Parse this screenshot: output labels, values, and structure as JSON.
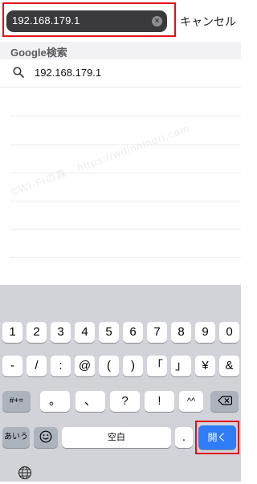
{
  "search": {
    "value": "192.168.179.1",
    "clear_icon": "clear-icon",
    "cancel_label": "キャンセル"
  },
  "suggestions": {
    "section_title": "Google検索",
    "items": [
      {
        "text": "192.168.179.1",
        "icon": "search-icon"
      }
    ]
  },
  "watermark": "©Wi-Fiの森 - https://wifinomori.com",
  "keyboard": {
    "row1": [
      "1",
      "2",
      "3",
      "4",
      "5",
      "6",
      "7",
      "8",
      "9",
      "0"
    ],
    "row2": [
      "-",
      "/",
      ":",
      "@",
      "(",
      ")",
      "「",
      "」",
      "¥",
      "&"
    ],
    "row3": {
      "shift_label": "#+=",
      "keys": [
        "。",
        "、",
        "?",
        "!",
        "^^"
      ],
      "backspace_icon": "backspace-icon"
    },
    "row4": {
      "kana_label": "あいう",
      "emoji_icon": "emoji-icon",
      "space_label": "空白",
      "period_label": ".",
      "open_label": "開く"
    },
    "globe_icon": "globe-icon"
  },
  "colors": {
    "highlight": "#e0101a",
    "accent": "#2f7cf6",
    "search_field_bg": "#3a3a3c"
  }
}
